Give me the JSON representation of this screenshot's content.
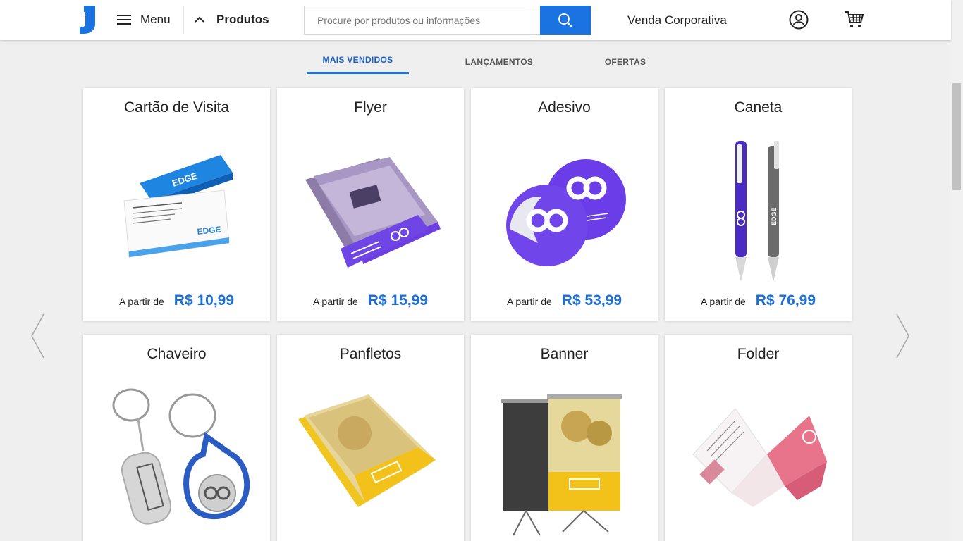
{
  "header": {
    "menu_label": "Menu",
    "produtos_label": "Produtos",
    "search_placeholder": "Procure por produtos ou informações",
    "corporate_label": "Venda Corporativa"
  },
  "tabs": [
    {
      "label": "MAIS VENDIDOS",
      "active": true
    },
    {
      "label": "LANÇAMENTOS",
      "active": false
    },
    {
      "label": "OFERTAS",
      "active": false
    }
  ],
  "products": [
    {
      "title": "Cartão de Visita",
      "from_label": "A partir de",
      "price": "R$ 10,99"
    },
    {
      "title": "Flyer",
      "from_label": "A partir de",
      "price": "R$ 15,99"
    },
    {
      "title": "Adesivo",
      "from_label": "A partir de",
      "price": "R$ 53,99"
    },
    {
      "title": "Caneta",
      "from_label": "A partir de",
      "price": "R$ 76,99"
    },
    {
      "title": "Chaveiro"
    },
    {
      "title": "Panfletos"
    },
    {
      "title": "Banner"
    },
    {
      "title": "Folder"
    }
  ],
  "colors": {
    "brand_blue": "#1a73e0",
    "price_blue": "#1a6fd8",
    "purple": "#6a3de8",
    "yellow": "#f2c21b",
    "pink": "#e8748c"
  }
}
